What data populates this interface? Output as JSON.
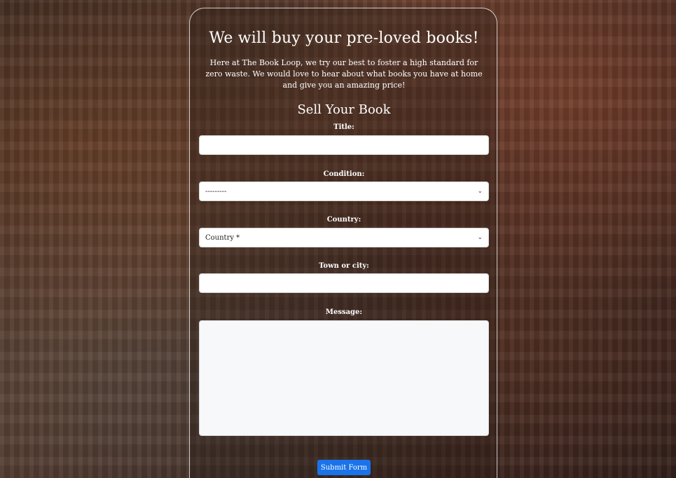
{
  "hero": {
    "heading": "We will buy your pre-loved books!",
    "intro": "Here at The Book Loop, we try our best to foster a high standard for zero waste. We would love to hear about what books you have at home and give you an amazing price!"
  },
  "form": {
    "title": "Sell Your Book",
    "fields": {
      "title": {
        "label": "Title:",
        "value": ""
      },
      "condition": {
        "label": "Condition:",
        "selected": "---------"
      },
      "country": {
        "label": "Country:",
        "selected": "Country *"
      },
      "town": {
        "label": "Town or city:",
        "value": ""
      },
      "message": {
        "label": "Message:",
        "value": ""
      }
    },
    "submit_label": "Submit Form"
  },
  "icons": {
    "select_arrow": "chevron-down-icon"
  },
  "colors": {
    "submit_button": "#1a73e8",
    "panel_border": "#ffffff",
    "textarea_bg": "#f7f8fa"
  }
}
